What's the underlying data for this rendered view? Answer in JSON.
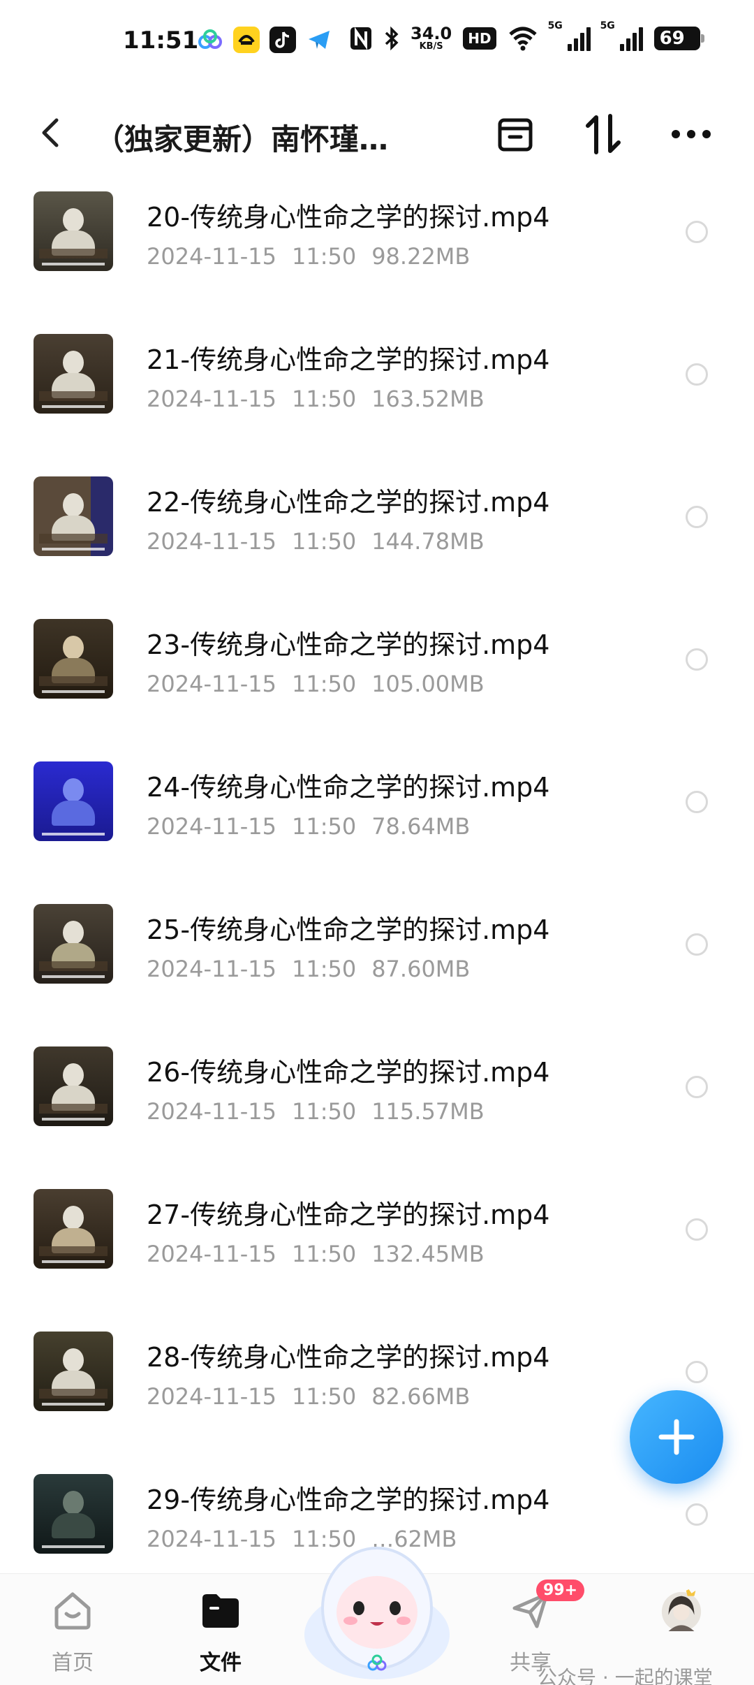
{
  "status_bar": {
    "time": "11:51",
    "net_speed_value": "34.0",
    "net_speed_unit": "KB/S",
    "hd_badge": "HD",
    "signal_1": "5G",
    "signal_2": "5G",
    "battery": "69"
  },
  "header": {
    "title": "（独家更新）南怀瑾…"
  },
  "files": [
    {
      "name": "20-传统身心性命之学的探讨.mp4",
      "date": "2024-11-15",
      "time": "11:50",
      "size": "98.22MB"
    },
    {
      "name": "21-传统身心性命之学的探讨.mp4",
      "date": "2024-11-15",
      "time": "11:50",
      "size": "163.52MB"
    },
    {
      "name": "22-传统身心性命之学的探讨.mp4",
      "date": "2024-11-15",
      "time": "11:50",
      "size": "144.78MB"
    },
    {
      "name": "23-传统身心性命之学的探讨.mp4",
      "date": "2024-11-15",
      "time": "11:50",
      "size": "105.00MB"
    },
    {
      "name": "24-传统身心性命之学的探讨.mp4",
      "date": "2024-11-15",
      "time": "11:50",
      "size": "78.64MB"
    },
    {
      "name": "25-传统身心性命之学的探讨.mp4",
      "date": "2024-11-15",
      "time": "11:50",
      "size": "87.60MB"
    },
    {
      "name": "26-传统身心性命之学的探讨.mp4",
      "date": "2024-11-15",
      "time": "11:50",
      "size": "115.57MB"
    },
    {
      "name": "27-传统身心性命之学的探讨.mp4",
      "date": "2024-11-15",
      "time": "11:50",
      "size": "132.45MB"
    },
    {
      "name": "28-传统身心性命之学的探讨.mp4",
      "date": "2024-11-15",
      "time": "11:50",
      "size": "82.66MB"
    },
    {
      "name": "29-传统身心性命之学的探讨.mp4",
      "date": "2024-11-15",
      "time": "11:50",
      "size": "…62MB"
    }
  ],
  "bottom_nav": {
    "home_label": "首页",
    "files_label": "文件",
    "share_label": "共享",
    "share_badge": "99+",
    "watermark": "公众号 · 一起的课堂"
  },
  "colors": {
    "accent": "#1a8cf0",
    "badge": "#ff4d6a",
    "meta_text": "#9a9a9a"
  }
}
